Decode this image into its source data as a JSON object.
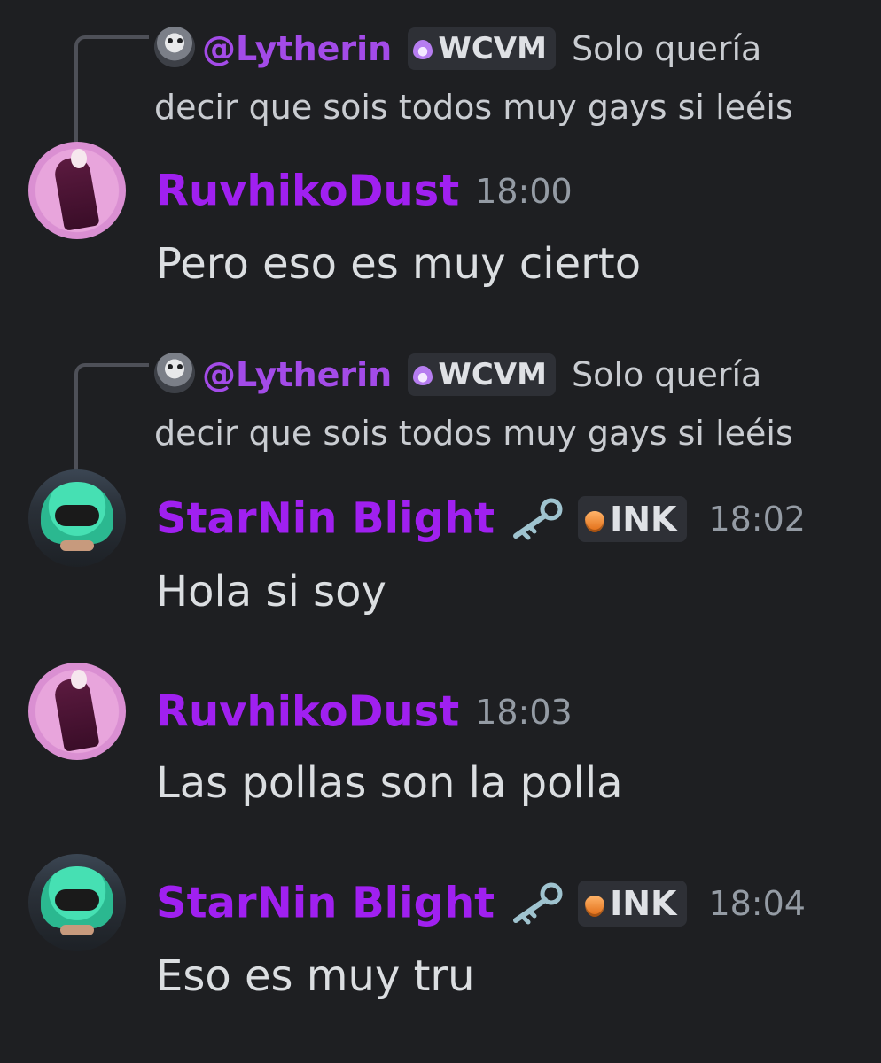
{
  "messages": [
    {
      "reply": {
        "author": "@Lytherin",
        "tag": "WCVM",
        "text_part1": "Solo quería",
        "text_part2": "decir que sois todos muy gays si leéis"
      },
      "author": "RuvhikoDust",
      "time": "18:00",
      "text": "Pero eso es muy cierto"
    },
    {
      "reply": {
        "author": "@Lytherin",
        "tag": "WCVM",
        "text_part1": "Solo quería",
        "text_part2": "decir que sois todos muy gays si leéis"
      },
      "author": "StarNin Blight",
      "tag": "INK",
      "time": "18:02",
      "text": "Hola si soy"
    },
    {
      "author": "RuvhikoDust",
      "time": "18:03",
      "text": "Las pollas son la polla"
    },
    {
      "author": "StarNin Blight",
      "tag": "INK",
      "time": "18:04",
      "text": "Eso es muy tru"
    }
  ],
  "colors": {
    "background": "#1e1f22",
    "author": "#a020f0",
    "reply_author": "#a34be8",
    "timestamp": "#949ba4",
    "text": "#dbdee1"
  },
  "icons": {
    "wcvm_tag_icon": "purple-flame-icon",
    "ink_tag_icon": "orange-drop-icon",
    "role_icon": "key-icon"
  }
}
